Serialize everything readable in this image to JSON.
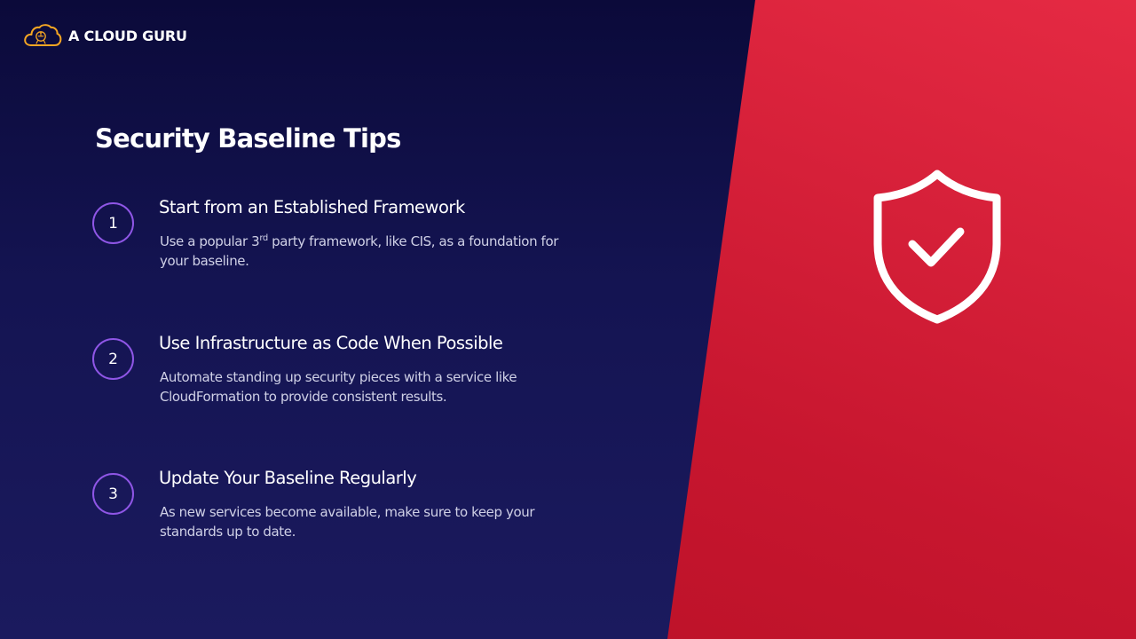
{
  "brand": {
    "name": "A CLOUD GURU",
    "logo_icon": "cloud-logo-icon",
    "logo_color": "#f5a623"
  },
  "slide": {
    "title": "Security Baseline Tips",
    "tips": [
      {
        "number": "1",
        "heading": "Start from an Established Framework",
        "desc_before": "Use a popular 3",
        "desc_sup": "rd",
        "desc_after": " party framework, like CIS, as a foundation for your baseline."
      },
      {
        "number": "2",
        "heading": "Use Infrastructure as Code When Possible",
        "desc": "Automate standing up security pieces with a service like CloudFormation to provide consistent results."
      },
      {
        "number": "3",
        "heading": "Update Your Baseline Regularly",
        "desc": "As new services become available, make sure to keep your standards up to date."
      }
    ]
  },
  "graphic": {
    "icon": "shield-check-icon"
  },
  "colors": {
    "background": "#141452",
    "accent_red": "#d71d36",
    "number_ring": "#8f56e6",
    "desc_text": "#cfd0e6"
  }
}
